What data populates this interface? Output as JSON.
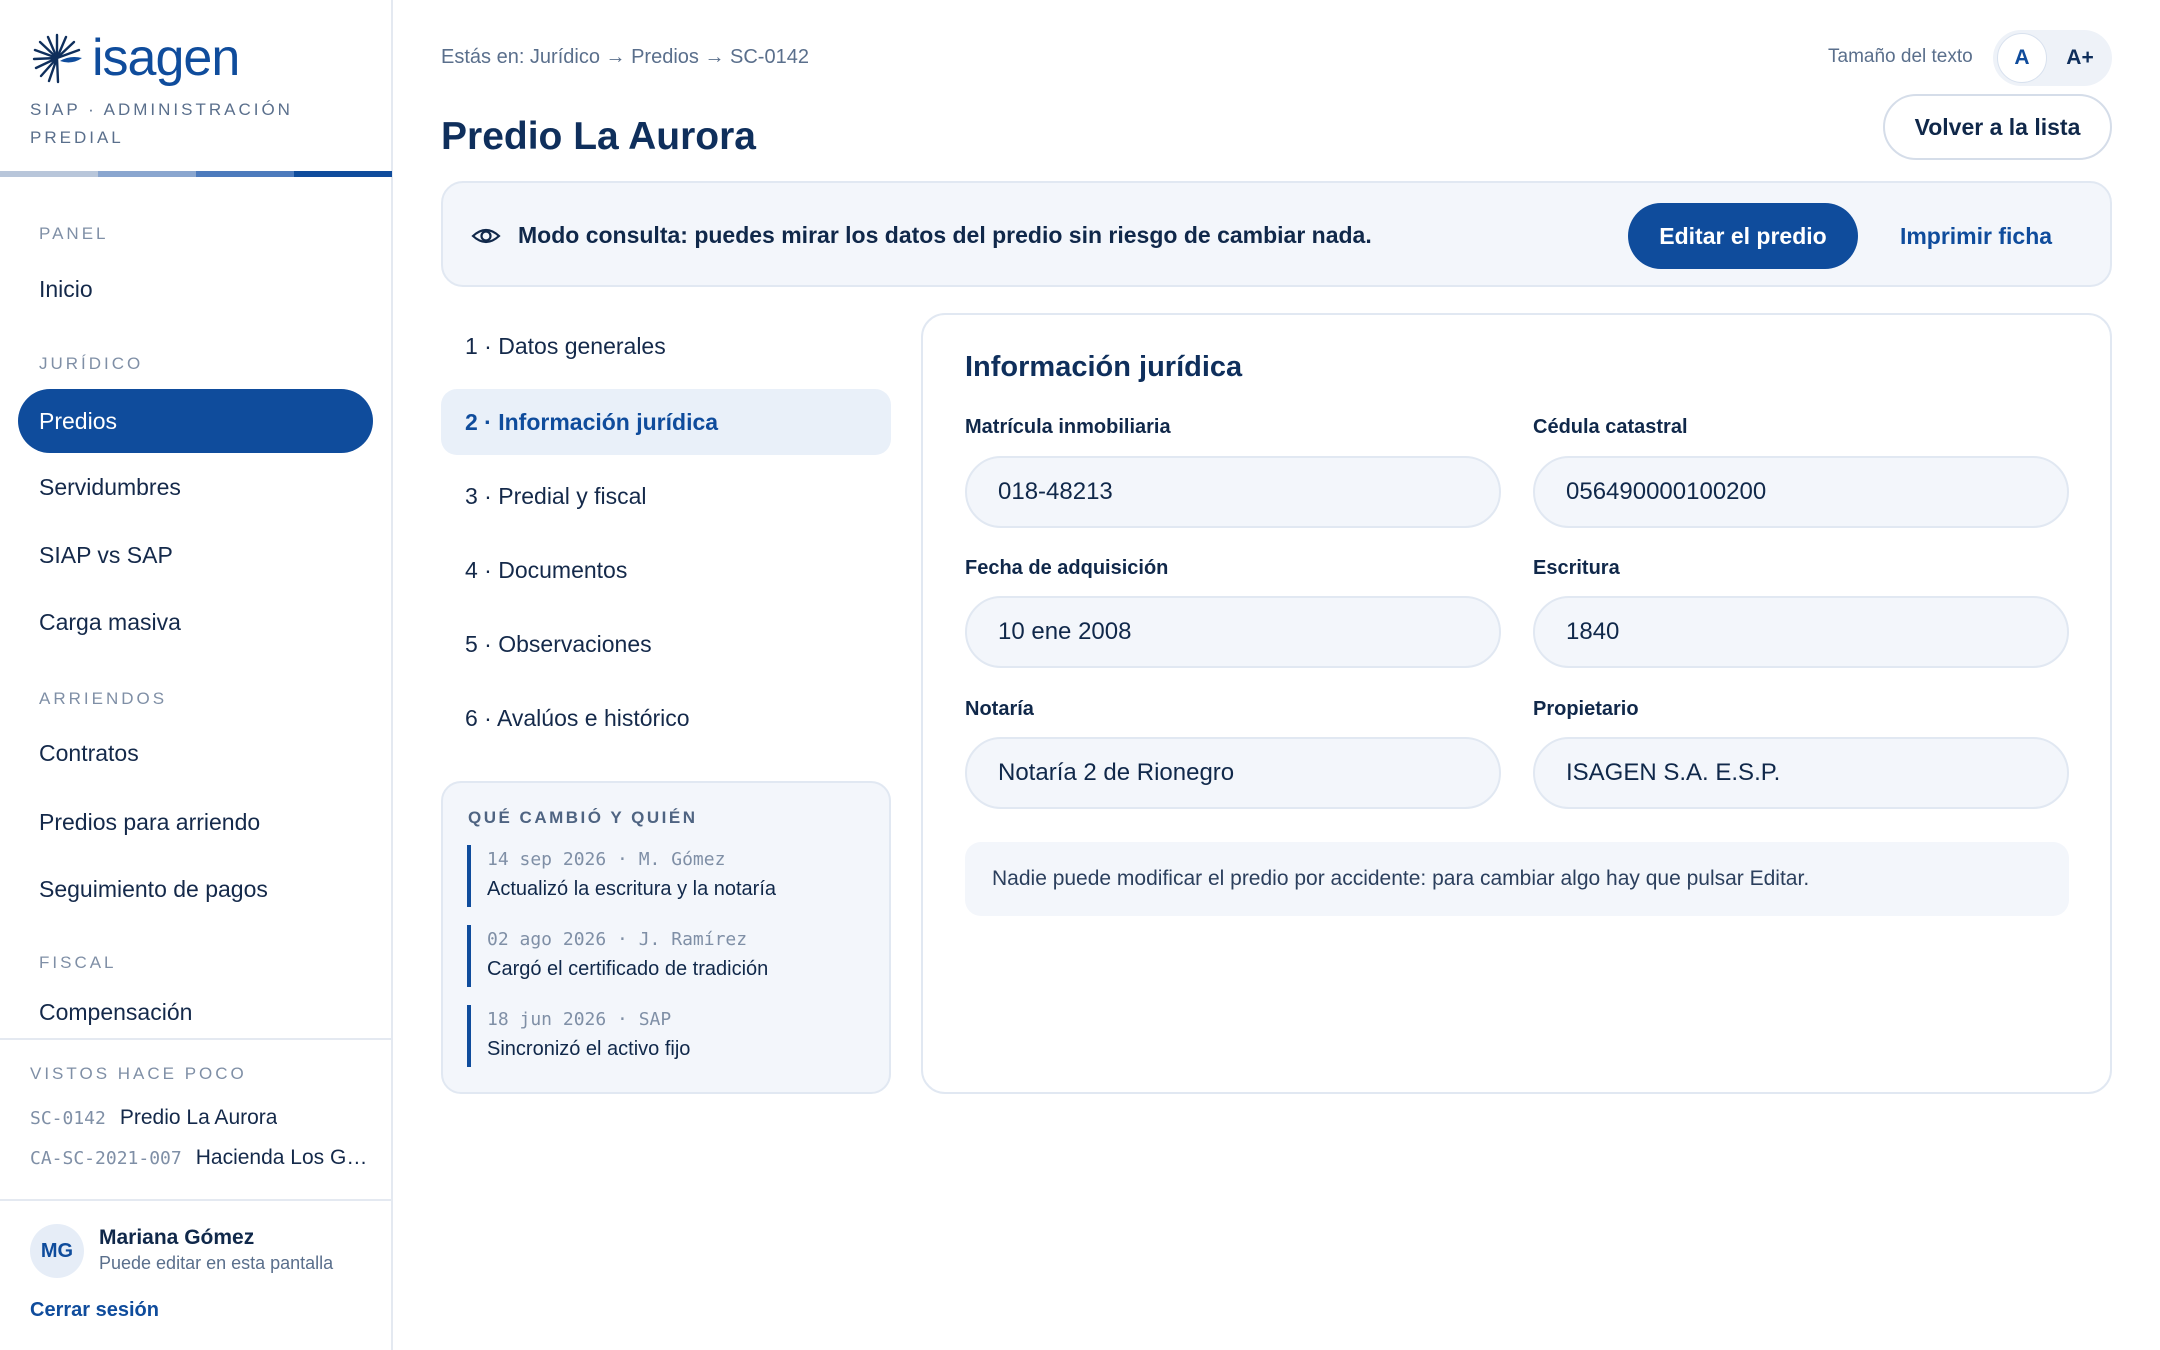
{
  "brand": {
    "name": "isagen",
    "subtitle": "SIAP · ADMINISTRACIÓN PREDIAL",
    "stripe_colors": [
      "#b8c6da",
      "#8aa6cf",
      "#4d7bbd",
      "#0f4c9c"
    ]
  },
  "colors": {
    "accent": "#0f4c9c",
    "text": "#10284a",
    "muted": "#5a6f8c"
  },
  "sidebar": {
    "sections": [
      {
        "label": "PANEL"
      },
      {
        "label": "JURÍDICO"
      },
      {
        "label": "ARRIENDOS"
      },
      {
        "label": "FISCAL"
      }
    ],
    "items": [
      {
        "label": "Inicio"
      },
      {
        "label": "Predios"
      },
      {
        "label": "Servidumbres"
      },
      {
        "label": "SIAP vs SAP"
      },
      {
        "label": "Carga masiva"
      },
      {
        "label": "Contratos"
      },
      {
        "label": "Predios para arriendo"
      },
      {
        "label": "Seguimiento de pagos"
      },
      {
        "label": "Compensación"
      }
    ],
    "recent": {
      "title": "VISTOS HACE POCO",
      "items": [
        {
          "code": "SC-0142",
          "name": "Predio La Aurora"
        },
        {
          "code": "CA-SC-2021-007",
          "name": "Hacienda Los Gu..."
        }
      ]
    },
    "user": {
      "initials": "MG",
      "name": "Mariana Gómez",
      "role": "Puede editar en esta pantalla",
      "logout": "Cerrar sesión"
    }
  },
  "header": {
    "breadcrumb": "Estás en: Jurídico → Predios → SC-0142",
    "title": "Predio La Aurora",
    "text_size_label": "Tamaño del texto",
    "text_size_small": "A",
    "text_size_large": "A+",
    "back_label": "Volver a la lista"
  },
  "banner": {
    "icon": "eye-icon",
    "text": "Modo consulta: puedes mirar los datos del predio sin riesgo de cambiar nada.",
    "edit_label": "Editar el predio",
    "print_label": "Imprimir ficha"
  },
  "steps": [
    {
      "label": "1 · Datos generales"
    },
    {
      "label": "2 · Información jurídica"
    },
    {
      "label": "3 · Predial y fiscal"
    },
    {
      "label": "4 · Documentos"
    },
    {
      "label": "5 · Observaciones"
    },
    {
      "label": "6 · Avalúos e histórico"
    }
  ],
  "history": {
    "title": "QUÉ CAMBIÓ Y QUIÉN",
    "entries": [
      {
        "meta": "14 sep 2026 · M. Gómez",
        "desc": "Actualizó la escritura y la notaría"
      },
      {
        "meta": "02 ago 2026 · J. Ramírez",
        "desc": "Cargó el certificado de tradición"
      },
      {
        "meta": "18 jun 2026 · SAP",
        "desc": "Sincronizó el activo fijo"
      }
    ]
  },
  "legal": {
    "title": "Información jurídica",
    "fields": [
      {
        "label": "Matrícula inmobiliaria",
        "value": "018-48213"
      },
      {
        "label": "Cédula catastral",
        "value": "056490000100200"
      },
      {
        "label": "Fecha de adquisición",
        "value": "10 ene 2008"
      },
      {
        "label": "Escritura",
        "value": "1840"
      },
      {
        "label": "Notaría",
        "value": "Notaría 2 de Rionegro"
      },
      {
        "label": "Propietario",
        "value": "ISAGEN S.A. E.S.P."
      }
    ],
    "note": "Nadie puede modificar el predio por accidente: para cambiar algo hay que pulsar Editar."
  }
}
